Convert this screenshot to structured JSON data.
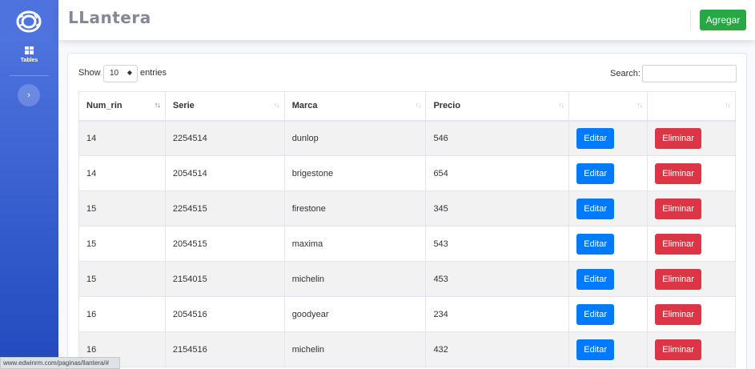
{
  "sidebar": {
    "brand_icon": "tire-icon",
    "nav_items": [
      {
        "label": "Tables",
        "icon": "table-icon"
      }
    ],
    "toggle_icon": "chevron-right-icon"
  },
  "topbar": {
    "title": "LLantera",
    "add_label": "Agregar"
  },
  "datatable": {
    "show_label": "Show",
    "entries_value": "10",
    "entries_label": "entries",
    "search_label": "Search:",
    "search_value": "",
    "columns": [
      "Num_rin",
      "Serie",
      "Marca",
      "Precio",
      "",
      ""
    ],
    "rows": [
      {
        "num_rin": "14",
        "serie": "2254514",
        "marca": "dunlop",
        "precio": "546"
      },
      {
        "num_rin": "14",
        "serie": "2054514",
        "marca": "brigestone",
        "precio": "654"
      },
      {
        "num_rin": "15",
        "serie": "2254515",
        "marca": "firestone",
        "precio": "345"
      },
      {
        "num_rin": "15",
        "serie": "2054515",
        "marca": "maxima",
        "precio": "543"
      },
      {
        "num_rin": "15",
        "serie": "2154015",
        "marca": "michelin",
        "precio": "453"
      },
      {
        "num_rin": "16",
        "serie": "2054516",
        "marca": "goodyear",
        "precio": "234"
      },
      {
        "num_rin": "16",
        "serie": "2154516",
        "marca": "michelin",
        "precio": "432"
      }
    ],
    "edit_label": "Editar",
    "delete_label": "Eliminar"
  },
  "status_bar": {
    "url": "www.edwinrm.com/paginas/llantera/#"
  },
  "colors": {
    "sidebar": "#4e73df",
    "add": "#28a745",
    "edit": "#007bff",
    "delete": "#dc3545"
  }
}
